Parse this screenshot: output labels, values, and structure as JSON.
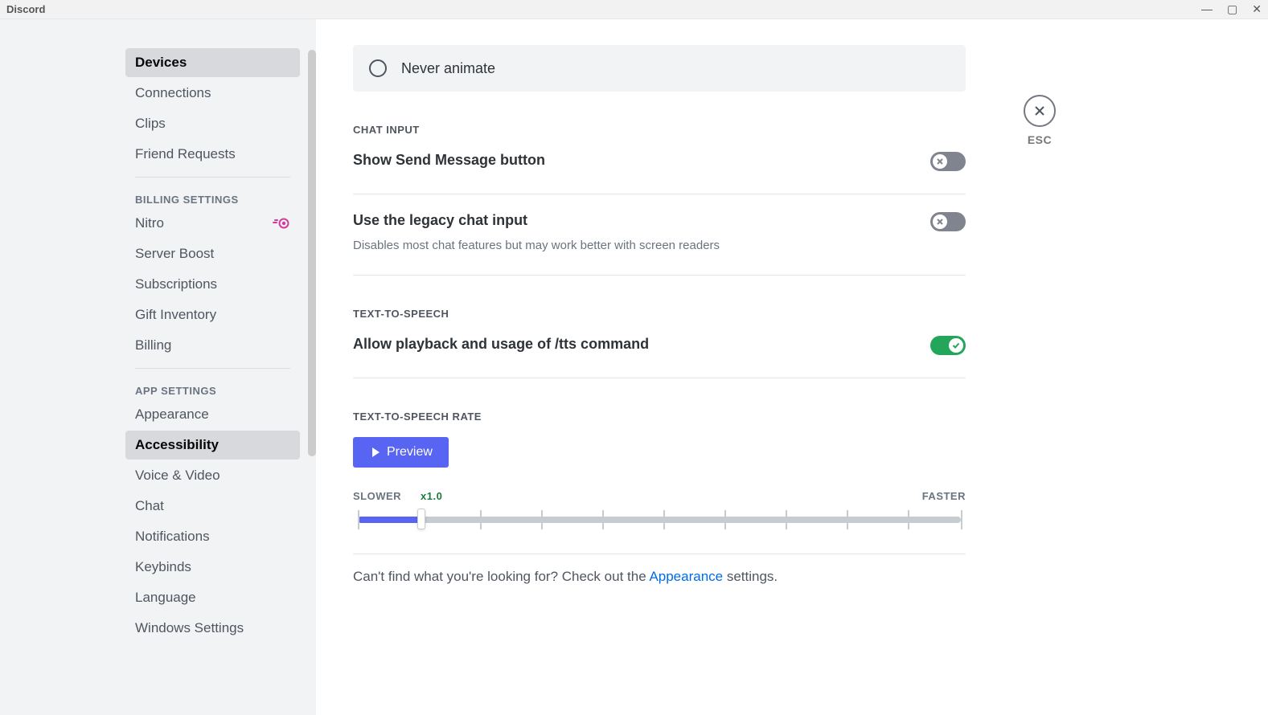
{
  "titlebar": {
    "title": "Discord"
  },
  "closeBtn": {
    "escLabel": "ESC"
  },
  "sidebar": {
    "items_user": [
      {
        "label": "Devices",
        "selected": true
      },
      {
        "label": "Connections"
      },
      {
        "label": "Clips"
      },
      {
        "label": "Friend Requests"
      }
    ],
    "heading_billing": "BILLING SETTINGS",
    "items_billing": [
      {
        "label": "Nitro",
        "nitro": true
      },
      {
        "label": "Server Boost"
      },
      {
        "label": "Subscriptions"
      },
      {
        "label": "Gift Inventory"
      },
      {
        "label": "Billing"
      }
    ],
    "heading_app": "APP SETTINGS",
    "items_app": [
      {
        "label": "Appearance"
      },
      {
        "label": "Accessibility",
        "selected": true
      },
      {
        "label": "Voice & Video"
      },
      {
        "label": "Chat"
      },
      {
        "label": "Notifications"
      },
      {
        "label": "Keybinds"
      },
      {
        "label": "Language"
      },
      {
        "label": "Windows Settings"
      }
    ]
  },
  "radio": {
    "neverAnimate": "Never animate"
  },
  "sections": {
    "chatInput": {
      "heading": "CHAT INPUT",
      "showSend": "Show Send Message button",
      "legacy": "Use the legacy chat input",
      "legacyDesc": "Disables most chat features but may work better with screen readers"
    },
    "tts": {
      "heading": "TEXT-TO-SPEECH",
      "allow": "Allow playback and usage of /tts command"
    },
    "ttsRate": {
      "heading": "TEXT-TO-SPEECH RATE",
      "preview": "Preview",
      "slower": "SLOWER",
      "faster": "FASTER",
      "rateLabel": "x1.0"
    }
  },
  "footer": {
    "pre": "Can't find what you're looking for? Check out the ",
    "link": "Appearance",
    "post": " settings."
  }
}
